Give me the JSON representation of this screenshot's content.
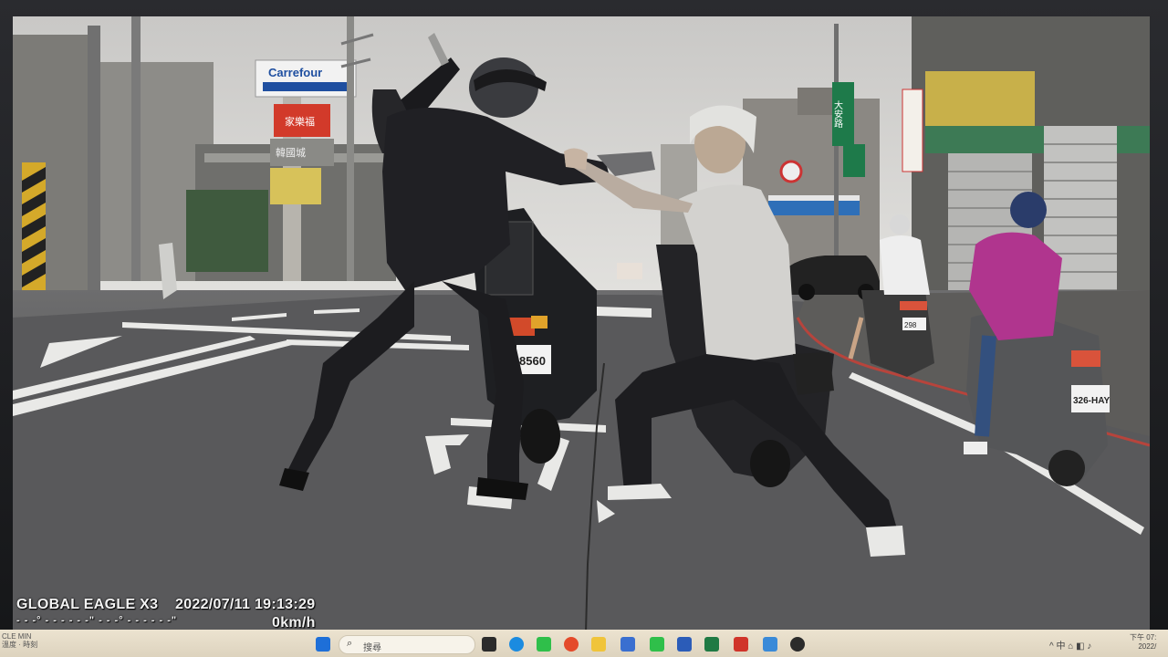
{
  "dashcam": {
    "device": "GLOBAL EAGLE X3",
    "datetime": "2022/07/11 19:13:29",
    "coords": "- - -° - - - - - -\"   - - -° - - - - - -\"",
    "speed": "0km/h"
  },
  "signs": {
    "carrefour": "Carrefour",
    "store_red": "家樂福",
    "store_sub": "韓國城",
    "street": "大安路",
    "plate_center": "8560",
    "plate_right": "326-HAY",
    "plate_rider": "298"
  },
  "taskbar": {
    "left_text_1": "CLE  MIN",
    "left_text_2": "溫度 · 時刻",
    "search_placeholder": "搜尋",
    "tray_text": "^  中  ⌂  ◧  ♪",
    "clock_line1": "下午 07:",
    "clock_line2": "2022/"
  },
  "colors": {
    "carrefour_blue": "#1f4fa0",
    "store_red": "#d23a2a",
    "street_sign_green": "#1e7a4a",
    "jacket_magenta": "#b0358e"
  }
}
